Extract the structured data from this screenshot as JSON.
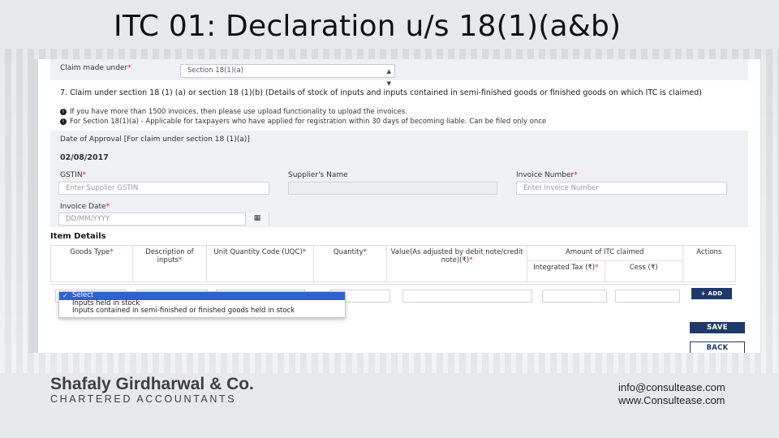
{
  "slide": {
    "title": "ITC 01: Declaration u/s 18(1)(a&b)"
  },
  "form": {
    "claim_label": "Claim made under",
    "claim_value": "Section 18(1)(a)",
    "section_heading": "7. Claim under section 18 (1) (a) or section 18 (1)(b) (Details of stock of inputs and inputs contained in semi-finished goods or finished goods on which ITC is claimed)",
    "info1": "If you have more than 1500 invoices, then please use upload functionality to upload the invoices.",
    "info2": "For Section 18(1)(a) - Applicable for taxpayers who have applied for registration within 30 days of becoming liable. Can be filed only once",
    "approval_label": "Date of Approval [For claim under section 18 (1)(a)]",
    "approval_date": "02/08/2017",
    "gstin_label": "GSTIN",
    "gstin_placeholder": "Enter Supplier GSTIN",
    "supplier_label": "Supplier's Name",
    "invoice_no_label": "Invoice Number",
    "invoice_no_placeholder": "Enter Invoice Number",
    "invoice_date_label": "Invoice Date",
    "invoice_date_placeholder": "DD/MM/YYYY",
    "calendar_icon": "calendar-icon",
    "req_mark": "*"
  },
  "items": {
    "title": "Item Details",
    "headers": {
      "goods_type": "Goods Type",
      "description": "Description of inputs",
      "uqc": "Unit Quantity Code (UQC)",
      "quantity": "Quantity",
      "value": "Value(As adjusted by debit note/credit note)(₹)",
      "amount_itc": "Amount of ITC claimed",
      "integrated_tax": "Integrated Tax (₹)",
      "cess": "Cess (₹)",
      "actions": "Actions"
    },
    "dropdown_options": [
      "Select",
      "Inputs held in stock",
      "Inputs contained in semi-finished or finished goods held in stock"
    ],
    "add_label": "+ ADD"
  },
  "buttons": {
    "save": "SAVE",
    "back": "BACK"
  },
  "footer": {
    "firm": "Shafaly Girdharwal & Co.",
    "subtitle": "CHARTERED ACCOUNTANTS",
    "email": "info@consultease.com",
    "website": "www.Consultease.com"
  },
  "colors": {
    "primary": "#1f3a6a",
    "selected_option": "#2f62cf",
    "required": "#d4202c"
  }
}
